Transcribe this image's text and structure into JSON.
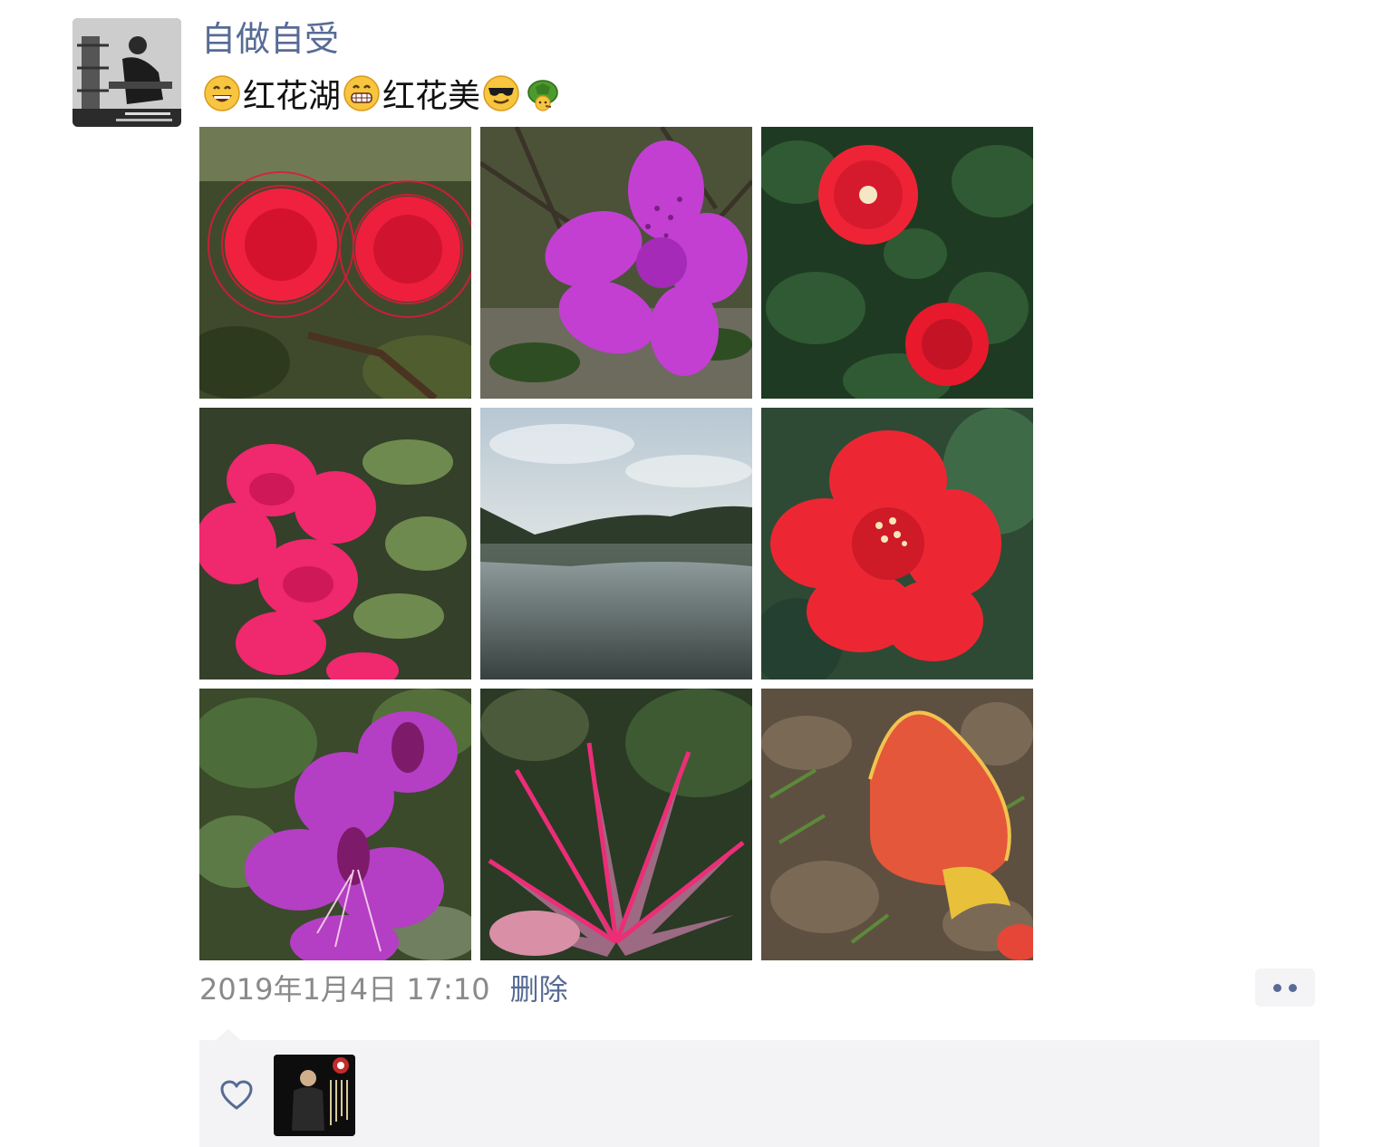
{
  "post": {
    "author_name": "自做自受",
    "text_segments": [
      "红花湖",
      "红花美"
    ],
    "emoji_icons": [
      "grinning-face-icon",
      "grinning-teeth-face-icon",
      "sunglasses-face-icon",
      "turtle-icon"
    ],
    "photos": [
      {
        "name": "photo-red-powderpuff"
      },
      {
        "name": "photo-purple-azalea"
      },
      {
        "name": "photo-red-hibiscus-bush"
      },
      {
        "name": "photo-pink-bougainvillea"
      },
      {
        "name": "photo-lake"
      },
      {
        "name": "photo-red-hibiscus-closeup"
      },
      {
        "name": "photo-purple-orchid-tree"
      },
      {
        "name": "photo-pink-ti-plant"
      },
      {
        "name": "photo-fallen-red-flower"
      }
    ],
    "timestamp": "2019年1月4日 17:10",
    "delete_label": "删除"
  },
  "likes": {
    "icon": "heart-outline-icon"
  },
  "colors": {
    "link": "#576b95",
    "timestamp": "#8a8a8a",
    "panel": "#f3f3f5"
  }
}
